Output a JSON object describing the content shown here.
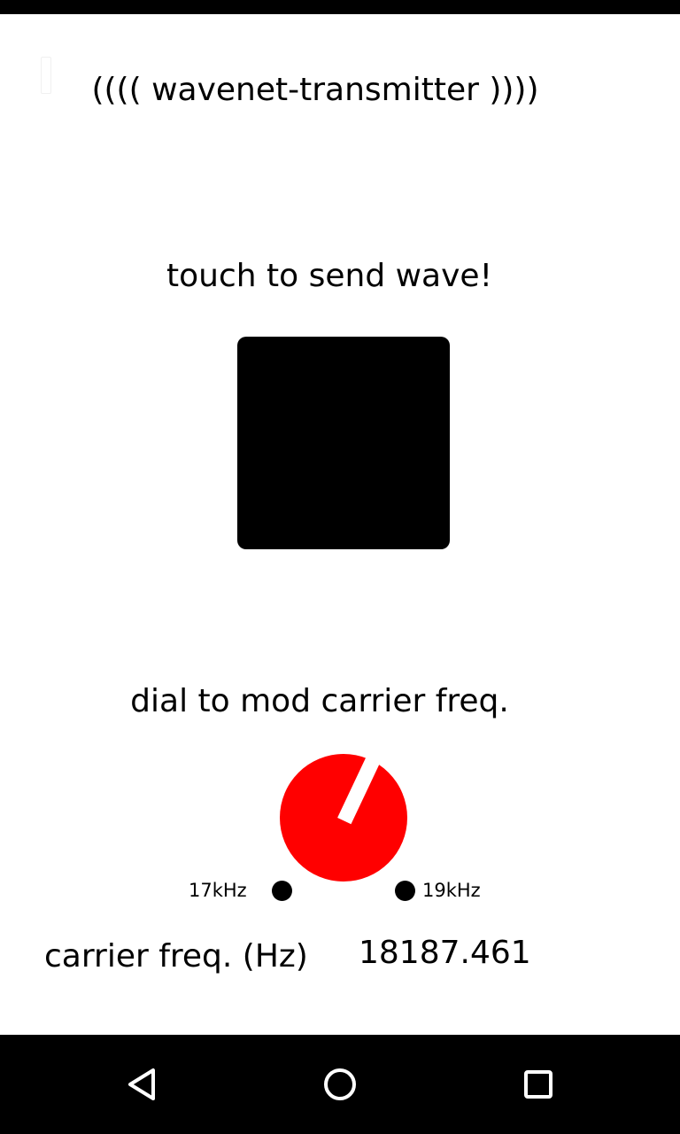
{
  "app": {
    "title": "(((( wavenet-transmitter ))))"
  },
  "touch_section": {
    "instruction": "touch to send wave!"
  },
  "dial_section": {
    "instruction": "dial to mod carrier freq.",
    "min_label": "17kHz",
    "max_label": "19kHz",
    "min_hz": 17000,
    "max_hz": 19000,
    "value_hz": 18187.461
  },
  "readout": {
    "label": "carrier freq. (Hz)",
    "value": "18187.461"
  },
  "colors": {
    "dial": "#ff0000",
    "pad": "#000000",
    "background": "#ffffff"
  },
  "nav_bar": {
    "buttons": [
      "back-icon",
      "home-icon",
      "recents-icon"
    ]
  }
}
